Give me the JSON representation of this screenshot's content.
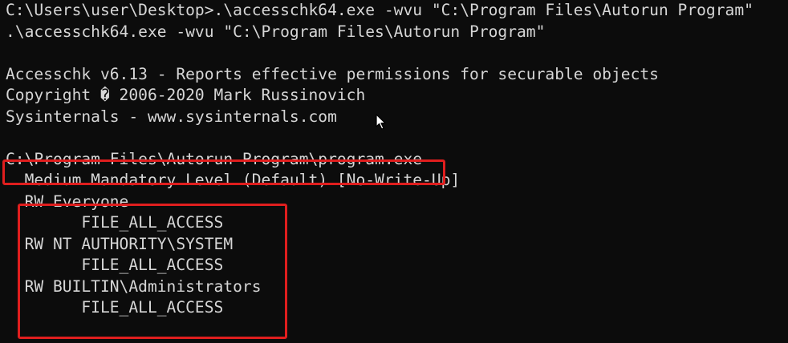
{
  "terminal": {
    "lines": [
      "C:\\Users\\user\\Desktop>.\\accesschk64.exe -wvu \"C:\\Program Files\\Autorun Program\"",
      ".\\accesschk64.exe -wvu \"C:\\Program Files\\Autorun Program\"",
      "",
      "Accesschk v6.13 - Reports effective permissions for securable objects",
      "Copyright � 2006-2020 Mark Russinovich",
      "Sysinternals - www.sysinternals.com",
      "",
      "C:\\Program Files\\Autorun Program\\program.exe",
      "  Medium Mandatory Level (Default) [No-Write-Up]",
      "  RW Everyone",
      "        FILE_ALL_ACCESS",
      "  RW NT AUTHORITY\\SYSTEM",
      "        FILE_ALL_ACCESS",
      "  RW BUILTIN\\Administrators",
      "        FILE_ALL_ACCESS"
    ]
  },
  "colors": {
    "background": "#0c0c0c",
    "text": "#d6d6d6",
    "highlight": "#e01e1e"
  },
  "icons": {
    "cursor": "mouse-pointer-icon"
  }
}
